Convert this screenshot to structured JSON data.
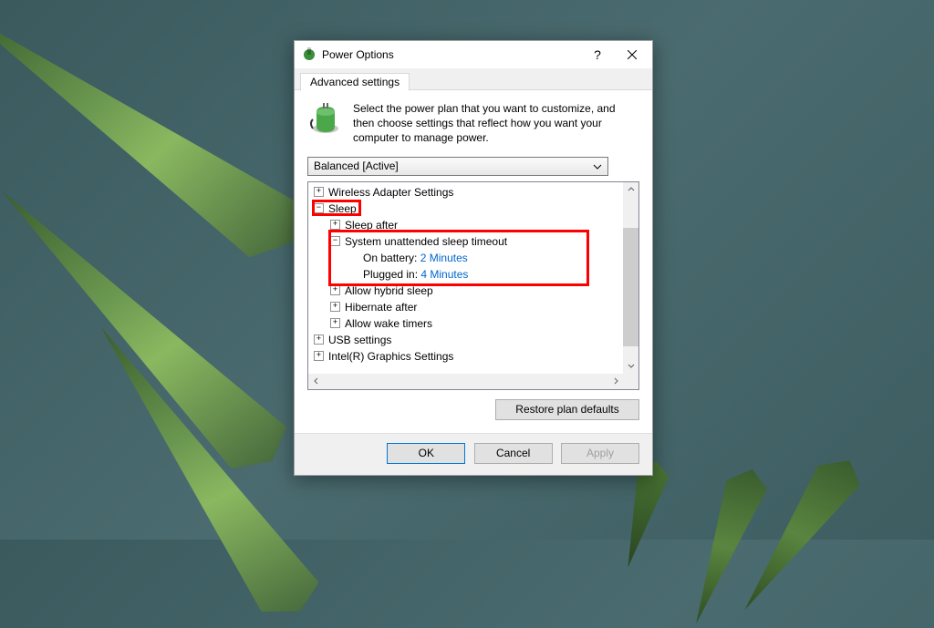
{
  "window": {
    "title": "Power Options",
    "help_glyph": "?",
    "tabs": {
      "advanced": "Advanced settings"
    },
    "intro": "Select the power plan that you want to customize, and then choose settings that reflect how you want your computer to manage power.",
    "plan_selected": "Balanced [Active]"
  },
  "tree": {
    "items": [
      {
        "label": "Wireless Adapter Settings",
        "depth": 0,
        "exp": "+"
      },
      {
        "label": "Sleep",
        "depth": 0,
        "exp": "−"
      },
      {
        "label": "Sleep after",
        "depth": 1,
        "exp": "+"
      },
      {
        "label": "System unattended sleep timeout",
        "depth": 1,
        "exp": "−"
      },
      {
        "label": "On battery:",
        "value": "2 Minutes",
        "depth": 2
      },
      {
        "label": "Plugged in:",
        "value": "4 Minutes",
        "depth": 2
      },
      {
        "label": "Allow hybrid sleep",
        "depth": 1,
        "exp": "+"
      },
      {
        "label": "Hibernate after",
        "depth": 1,
        "exp": "+"
      },
      {
        "label": "Allow wake timers",
        "depth": 1,
        "exp": "+"
      },
      {
        "label": "USB settings",
        "depth": 0,
        "exp": "+"
      },
      {
        "label": "Intel(R) Graphics Settings",
        "depth": 0,
        "exp": "+"
      }
    ]
  },
  "buttons": {
    "restore": "Restore plan defaults",
    "ok": "OK",
    "cancel": "Cancel",
    "apply": "Apply"
  }
}
